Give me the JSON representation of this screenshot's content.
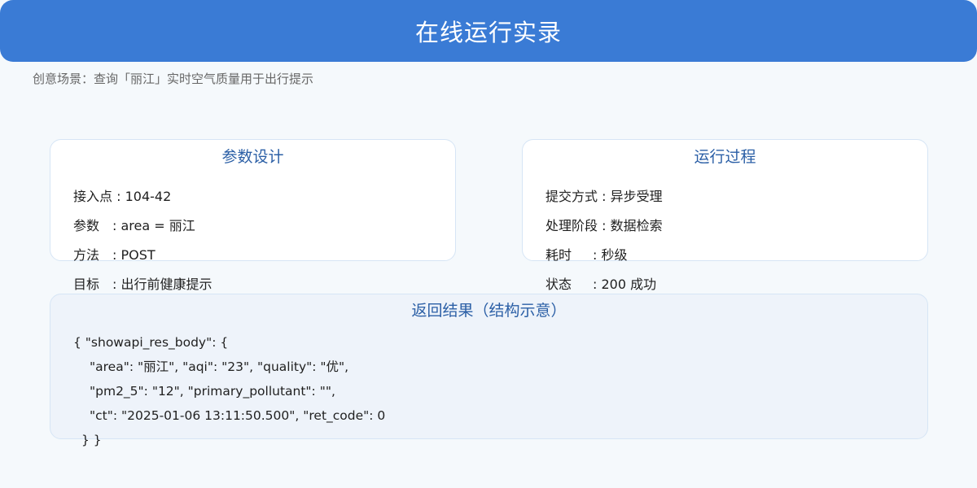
{
  "header": {
    "title": "在线运行实录"
  },
  "scenario": {
    "label": "创意场景：",
    "text": "查询「丽江」实时空气质量用于出行提示"
  },
  "params_card": {
    "title": "参数设计",
    "rows": [
      {
        "key": "接入点",
        "value": ": 104-42"
      },
      {
        "key": "参数",
        "value": ": area = 丽江"
      },
      {
        "key": "方法",
        "value": ": POST"
      },
      {
        "key": "目标",
        "value": ": 出行前健康提示"
      }
    ]
  },
  "process_card": {
    "title": "运行过程",
    "rows": [
      {
        "key": "提交方式",
        "value": ": 异步受理"
      },
      {
        "key": "处理阶段",
        "value": ": 数据检索"
      },
      {
        "key": "耗时",
        "value": ": 秒级"
      },
      {
        "key": "状态",
        "value": ": 200 成功"
      }
    ]
  },
  "result_card": {
    "title": "返回结果（结构示意）",
    "lines": [
      "{ \"showapi_res_body\": {",
      "\"area\": \"丽江\", \"aqi\": \"23\", \"quality\": \"优\",",
      "\"pm2_5\": \"12\", \"primary_pollutant\": \"\",",
      "\"ct\": \"2025-01-06 13:11:50.500\", \"ret_code\": 0",
      "} }"
    ]
  }
}
